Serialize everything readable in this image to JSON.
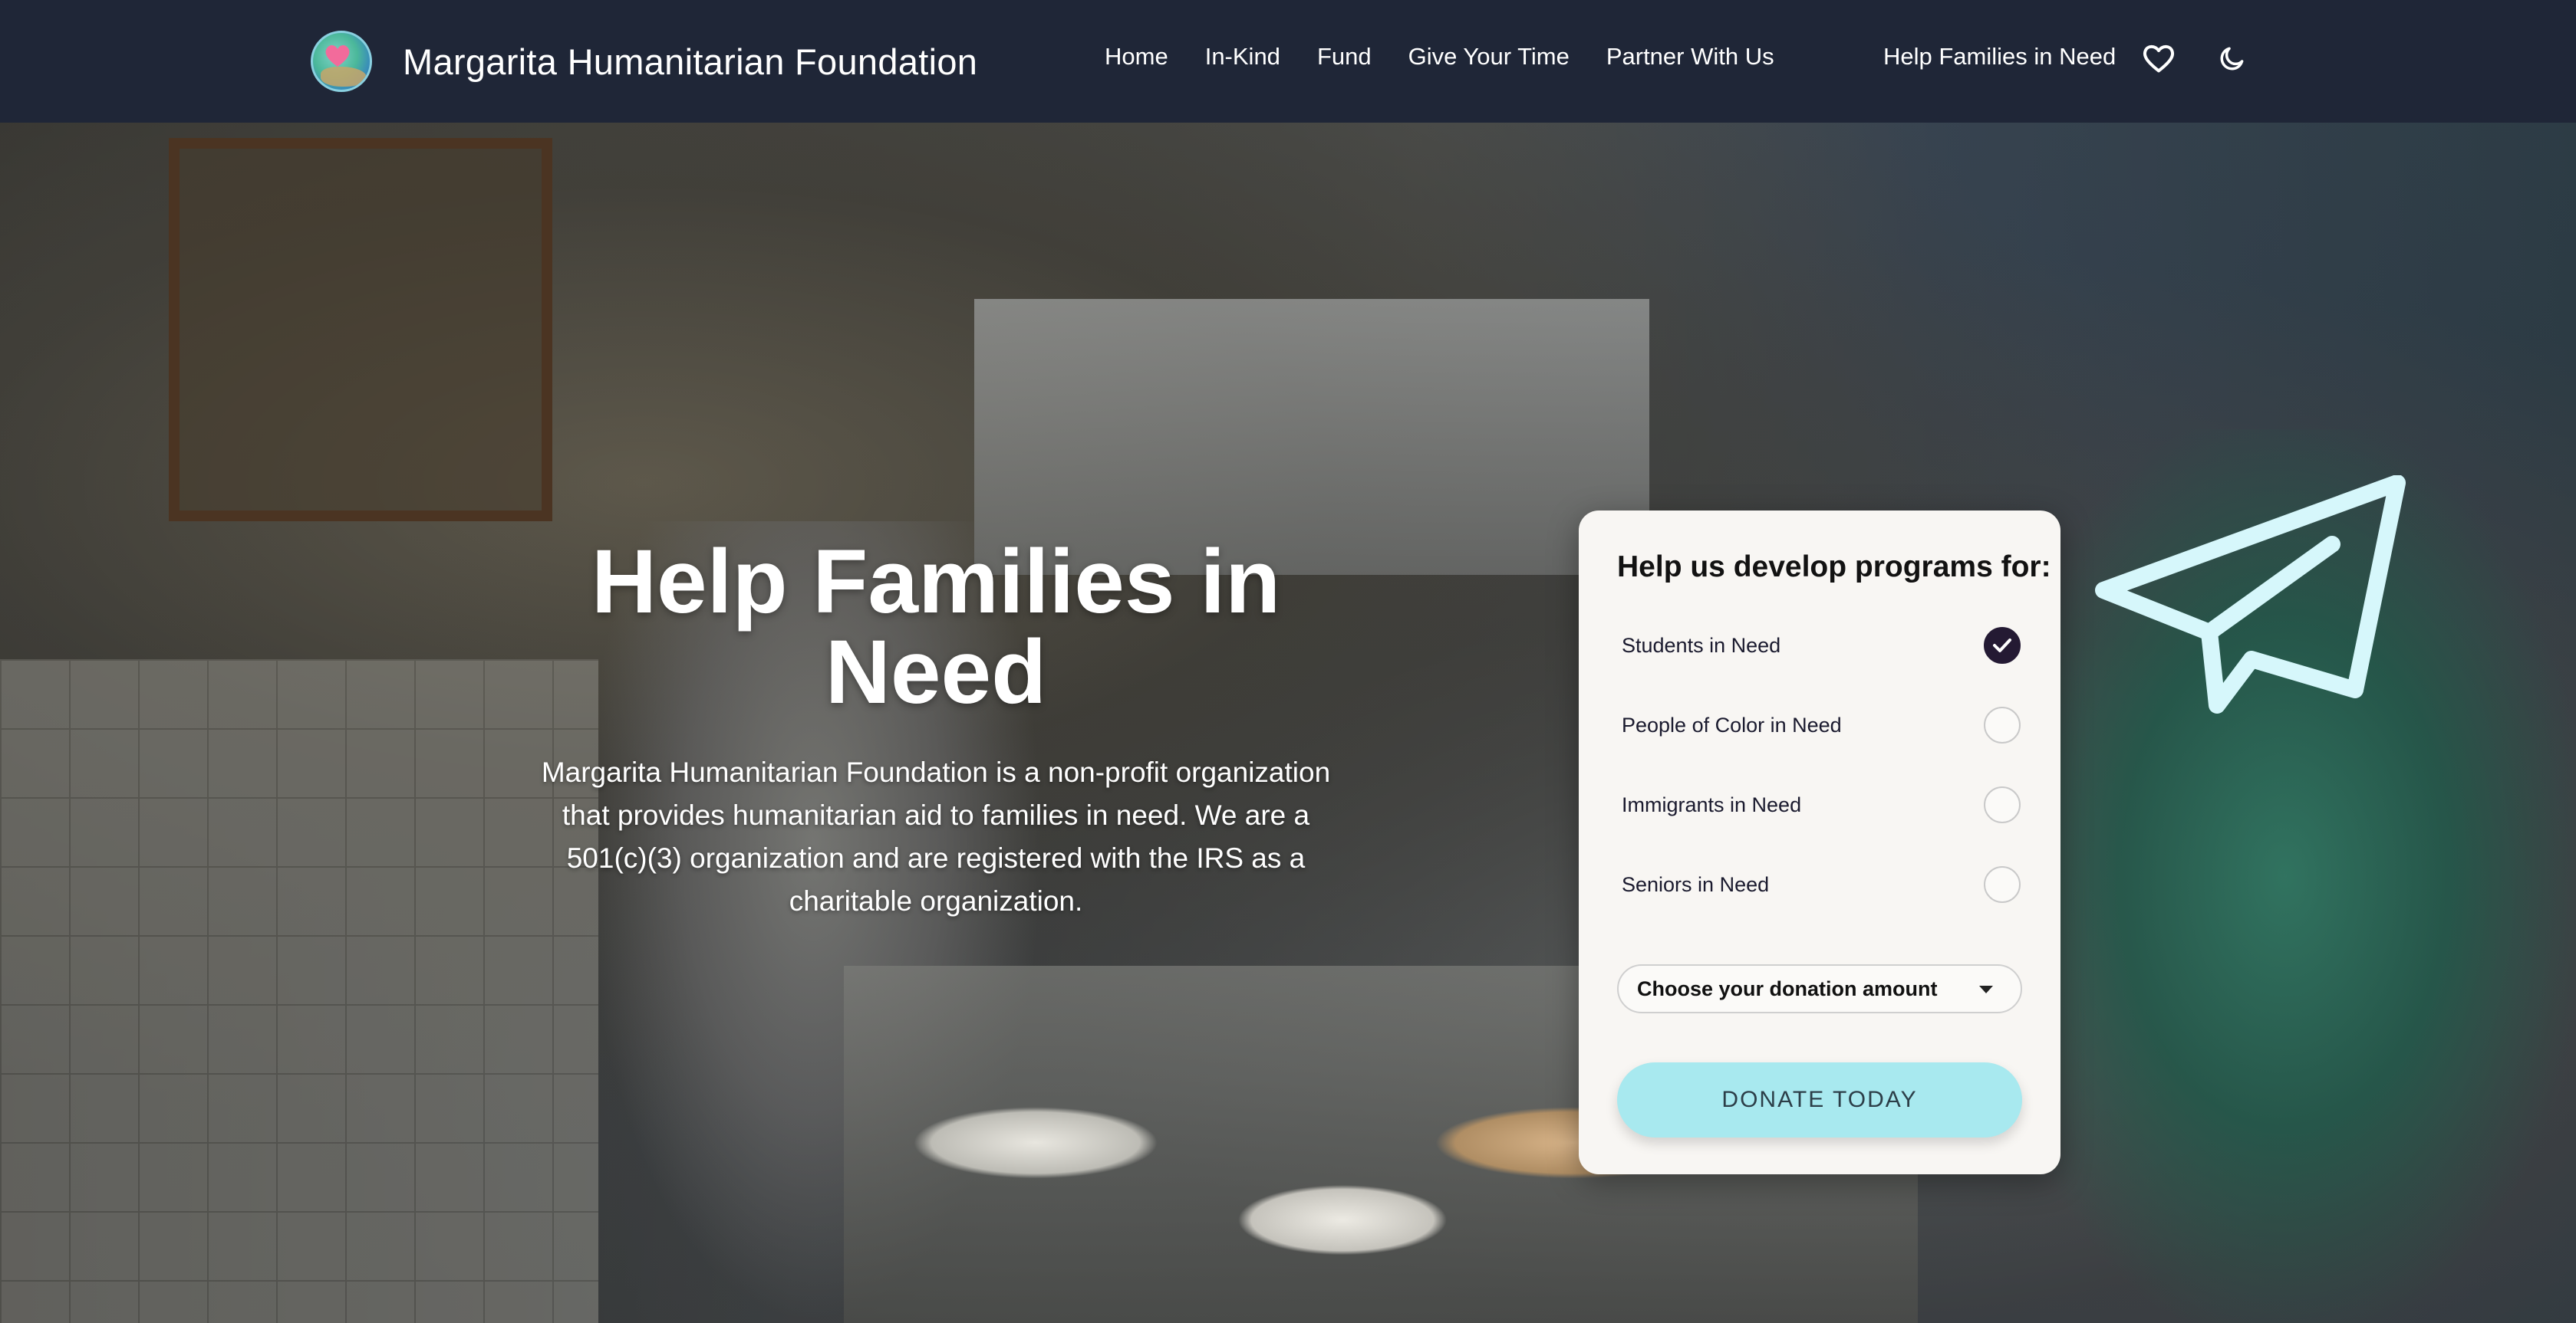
{
  "navbar": {
    "brand": "Margarita Humanitarian Foundation",
    "links": [
      "Home",
      "In-Kind",
      "Fund",
      "Give Your Time",
      "Partner With Us"
    ],
    "cta": "Help Families in Need",
    "icons": {
      "favorites": "heart-icon",
      "theme": "moon-icon",
      "logo": "globe-heart-logo"
    }
  },
  "hero": {
    "title": "Help Families in Need",
    "description": "Margarita Humanitarian Foundation is a non-profit organization that provides humanitarian aid to families in need. We are a 501(c)(3) organization and are registered with the IRS as a charitable organization."
  },
  "donation_card": {
    "title": "Help us develop programs for:",
    "options": [
      {
        "label": "Students in Need",
        "checked": true
      },
      {
        "label": "People of Color in Need",
        "checked": false
      },
      {
        "label": "Immigrants in Need",
        "checked": false
      },
      {
        "label": "Seniors in Need",
        "checked": false
      }
    ],
    "amount_select": "Choose your donation amount",
    "button": "DONATE TODAY"
  },
  "colors": {
    "navbar_bg": "#1f2637",
    "card_bg": "#f8f6f3",
    "button_bg": "#a8e9ef",
    "checked_radio": "#241a33",
    "plane_stroke": "#d6f7fb"
  }
}
